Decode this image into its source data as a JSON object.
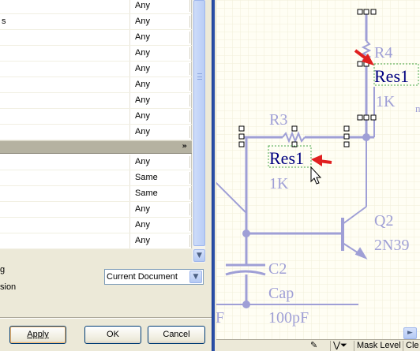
{
  "properties": {
    "rows_top": [
      {
        "name": "",
        "value": "Any"
      },
      {
        "name": "s",
        "value": "Any"
      },
      {
        "name": "",
        "value": "Any"
      },
      {
        "name": "",
        "value": "Any"
      },
      {
        "name": "",
        "value": "Any"
      },
      {
        "name": "",
        "value": "Any"
      },
      {
        "name": "",
        "value": "Any"
      },
      {
        "name": "",
        "value": "Any"
      },
      {
        "name": "",
        "value": "Any"
      }
    ],
    "group_collapse_icon": "chevron-double-down-icon",
    "rows_bottom": [
      {
        "name": "",
        "value": "Any"
      },
      {
        "name": "",
        "value": "Same"
      },
      {
        "name": "",
        "value": "Same"
      },
      {
        "name": "",
        "value": "Any"
      },
      {
        "name": "",
        "value": "Any"
      },
      {
        "name": "",
        "value": "Any"
      }
    ]
  },
  "options": {
    "label_1": "g",
    "label_2": "sion",
    "scope_value": "Current Document"
  },
  "buttons": {
    "apply": "Apply",
    "ok": "OK",
    "cancel": "Cancel"
  },
  "schematic": {
    "r4": {
      "designator": "R4",
      "comment": "Res1",
      "value": "1K"
    },
    "r3": {
      "designator": "R3",
      "comment": "Res1",
      "value": "1K"
    },
    "q2": {
      "designator": "Q2",
      "comment": "2N39"
    },
    "c2": {
      "designator": "C2",
      "comment": "Cap",
      "value": "100pF"
    },
    "partial_label_f": "F",
    "partial_label_m": "m",
    "colors": {
      "wire": "#9f9fd6",
      "selected_text": "#000080",
      "selection_box": "#4aa84a",
      "arrow": "#e02020"
    }
  },
  "statusbar": {
    "mask_level": "Mask Level",
    "clear": "Cle"
  }
}
